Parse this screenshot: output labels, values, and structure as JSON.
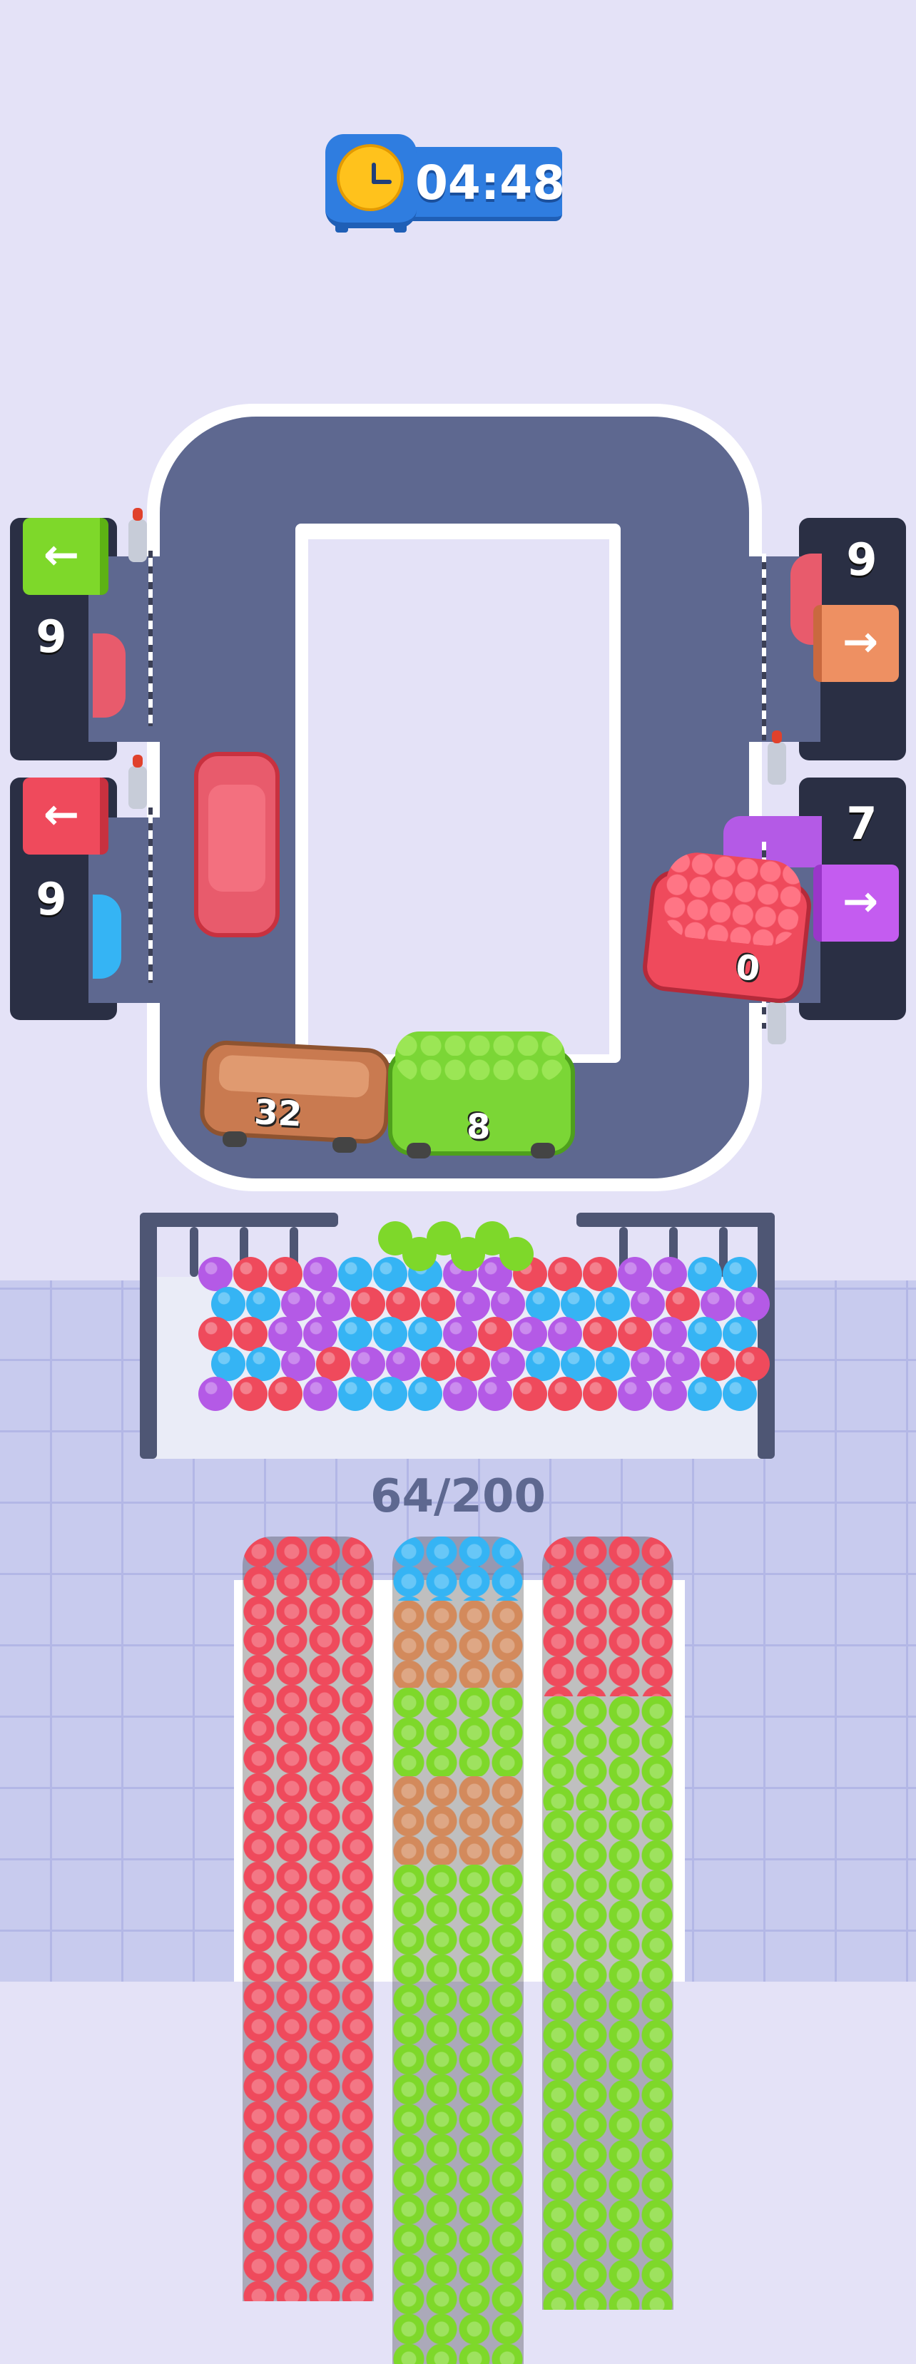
{
  "timer": {
    "value": "04:48",
    "icon": "alarm-clock-icon"
  },
  "docks": [
    {
      "id": "left-top",
      "count": "9",
      "arrow": "←",
      "flag_color": "#7ed82a"
    },
    {
      "id": "left-bottom",
      "count": "9",
      "arrow": "←",
      "flag_color": "#ef4a5c"
    },
    {
      "id": "right-top",
      "count": "9",
      "arrow": "→",
      "flag_color": "#ee9062"
    },
    {
      "id": "right-bottom",
      "count": "7",
      "arrow": "→",
      "flag_color": "#c45cf0"
    }
  ],
  "buses": [
    {
      "color": "#e85b6c",
      "label": ""
    },
    {
      "color": "#c97a50",
      "label": "32"
    },
    {
      "color": "#7bd636",
      "label": "8"
    },
    {
      "color": "#ef4a5c",
      "label": "0"
    }
  ],
  "counter": {
    "current": "64/200"
  },
  "queues": [
    {
      "colors": [
        "red",
        "red",
        "red",
        "red"
      ]
    },
    {
      "colors": [
        "blue",
        "orange",
        "green",
        "orange",
        "green"
      ]
    },
    {
      "colors": [
        "red",
        "green",
        "green"
      ]
    }
  ],
  "palette": {
    "red": "#ef4a5c",
    "green": "#7ed82a",
    "blue": "#35b4f4",
    "purple": "#b45ae6",
    "orange": "#d38a5c"
  }
}
